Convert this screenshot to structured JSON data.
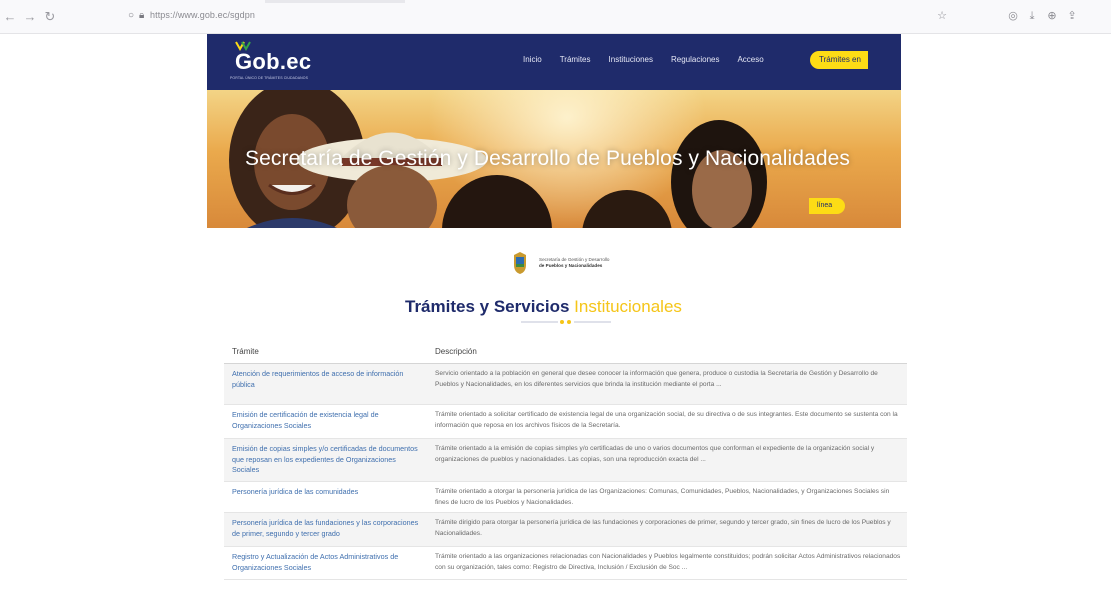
{
  "browser": {
    "url": "https://www.gob.ec/sgdpn",
    "colors": {
      "chrome": "#f9f9fb"
    }
  },
  "header": {
    "logo_text": "Gob.ec",
    "logo_sub": "PORTAL ÚNICO DE TRÁMITES CIUDADANOS",
    "nav": [
      "Inicio",
      "Trámites",
      "Instituciones",
      "Regulaciones",
      "Acceso"
    ],
    "cta_label": "Trámites en",
    "cta_label_cont": "línea",
    "colors": {
      "bar": "#1f2b6b",
      "cta": "#fddc15"
    }
  },
  "hero": {
    "title": "Secretaría de Gestión y Desarrollo de Pueblos y Nacionalidades"
  },
  "ministry": {
    "line1": "Secretaría de Gestión y Desarrollo",
    "line2": "de Pueblos y Nacionalidades"
  },
  "section": {
    "title_main": "Trámites y Servicios",
    "title_accent": "Institucionales"
  },
  "table": {
    "headers": [
      "Trámite",
      "Descripción"
    ],
    "rows": [
      {
        "tramite": "Atención de requerimientos de acceso de información pública",
        "descripcion": "Servicio orientado a la población en general que desee conocer la información que genera, produce o custodia la Secretaría de Gestión y Desarrollo de Pueblos y Nacionalidades, en los diferentes servicios que brinda la institución mediante el porta ..."
      },
      {
        "tramite": "Emisión de certificación de existencia legal de Organizaciones Sociales",
        "descripcion": "Trámite orientado a solicitar certificado de existencia legal de una organización social, de su directiva o de sus integrantes. Este documento se sustenta con la información que reposa en los archivos físicos de la Secretaría."
      },
      {
        "tramite": "Emisión de copias simples y/o certificadas de documentos que reposan en los expedientes de Organizaciones Sociales",
        "descripcion": "Trámite orientado a la emisión de copias simples y/o certificadas de uno o varios documentos que conforman el expediente de la organización social y organizaciones de pueblos y nacionalidades. Las copias, son una reproducción exacta del ..."
      },
      {
        "tramite": "Personería jurídica de las comunidades",
        "descripcion": "Trámite orientado a otorgar la personería jurídica de las Organizaciones: Comunas, Comunidades, Pueblos, Nacionalidades, y Organizaciones Sociales sin fines de lucro de los Pueblos y Nacionalidades."
      },
      {
        "tramite": "Personería jurídica de las fundaciones y las corporaciones de primer, segundo y tercer grado",
        "descripcion": "Trámite dirigido para otorgar la personería jurídica de las fundaciones y corporaciones de primer, segundo y tercer grado, sin fines de lucro de los Pueblos y Nacionalidades."
      },
      {
        "tramite": "Registro y Actualización de Actos Administrativos de Organizaciones Sociales",
        "descripcion": "Trámite orientado a las organizaciones relacionadas con Nacionalidades y Pueblos legalmente constituidos; podrán solicitar Actos Administrativos relacionados con su organización, tales como: Registro de Directiva, Inclusión / Exclusión de Soc ..."
      }
    ],
    "colors": {
      "link": "#3f6fae",
      "alt_row": "#f4f4f4"
    }
  }
}
